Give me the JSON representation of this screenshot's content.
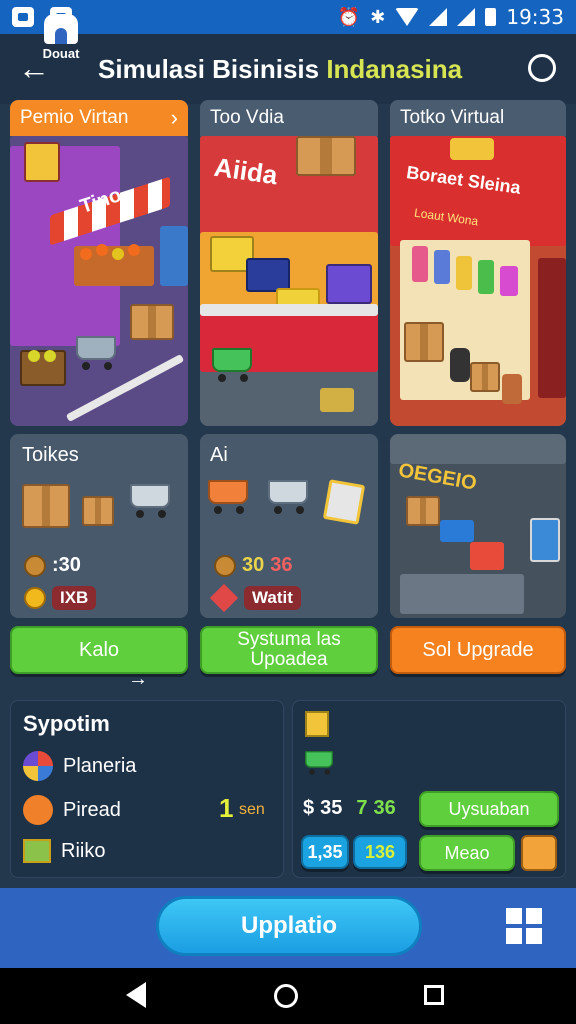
{
  "status_bar": {
    "time": "19:33"
  },
  "header": {
    "title_main": "Simulasi Bisinisis ",
    "title_accent": "Indanasina",
    "accent_color": "#d7e553"
  },
  "shops": [
    {
      "label": "Pemio Virtan"
    },
    {
      "label": "Too Vdia",
      "sign": "Aiida"
    },
    {
      "label": "Totko Virtual",
      "sign": "Boraet Sleina",
      "sub_sign": "Loaut  Wona"
    }
  ],
  "stalls": [
    {
      "label": "Toikes",
      "price": ":30",
      "badge": "IXB"
    },
    {
      "label": "Ai",
      "price_a": "30",
      "price_b": "36",
      "badge": "Watit"
    },
    {
      "sign": "OEGEIO"
    }
  ],
  "sign_box_a": "Tino",
  "actions": {
    "left": "Kalo",
    "middle": "Systuma las Upoadea",
    "right": "Sol Upgrade",
    "arrow": "→"
  },
  "system_panel": {
    "title": "Sypotim",
    "items": [
      {
        "label": "Planeria",
        "icon": "globe-icon"
      },
      {
        "label": "Piread",
        "icon": "orange-ball-icon"
      },
      {
        "label": "Riiko",
        "icon": "cube-icon"
      }
    ],
    "side_value": "1",
    "side_value_label": "sen"
  },
  "upgrade_panel": {
    "value_a": "35",
    "value_b": "7",
    "value_c": "36",
    "stat_a": "1,35",
    "stat_b": "136",
    "btn_top": "Uysuaban",
    "btn_bottom": "Meao"
  },
  "bottom_nav": {
    "home_label": "Douat",
    "main_button": "Upplatio"
  }
}
